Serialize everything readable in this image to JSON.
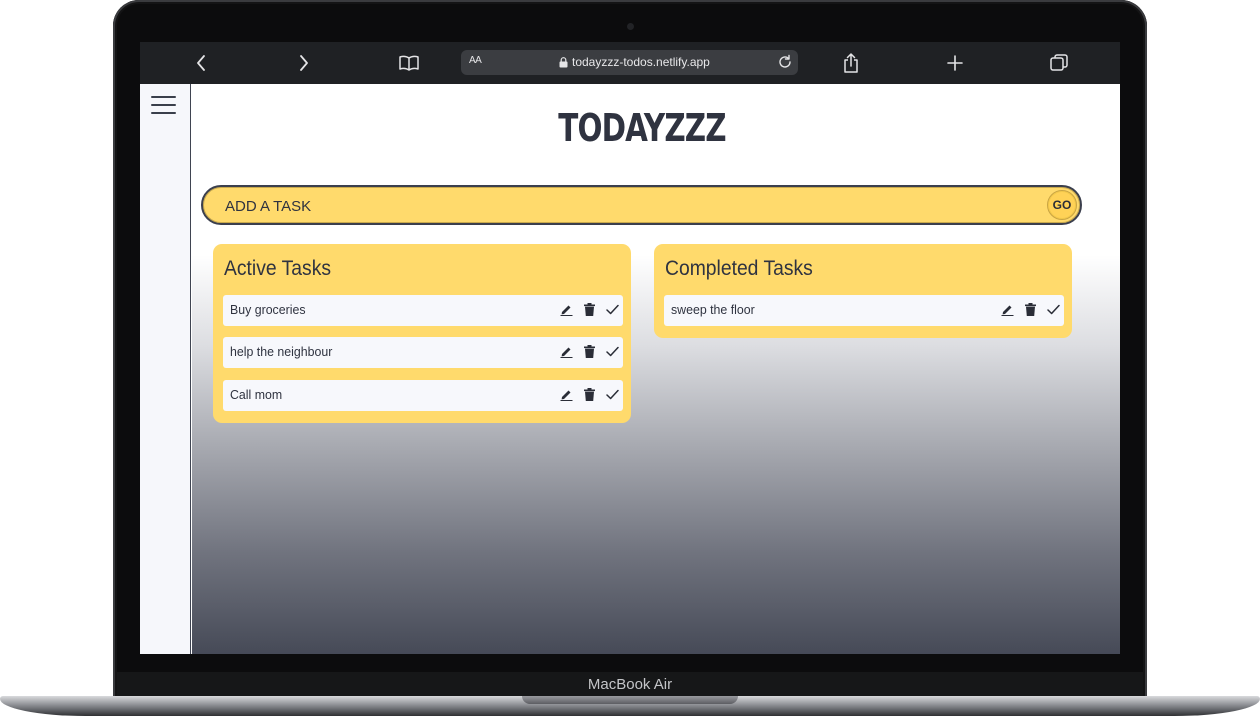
{
  "browser": {
    "text_size_label": "AA",
    "url": "todayzzz-todos.netlify.app"
  },
  "app": {
    "title": "TODAYZZZ",
    "task_input_placeholder": "ADD A TASK",
    "go_label": "GO"
  },
  "active": {
    "title": "Active Tasks",
    "tasks": [
      "Buy groceries",
      "help the neighbour",
      "Call mom"
    ]
  },
  "completed": {
    "title": "Completed Tasks",
    "tasks": [
      "sweep the floor"
    ]
  },
  "device": {
    "label": "MacBook Air"
  },
  "colors": {
    "accent_yellow": "#ffda6c",
    "text_dark": "#2f3340",
    "browser_chrome": "#1f2124"
  }
}
